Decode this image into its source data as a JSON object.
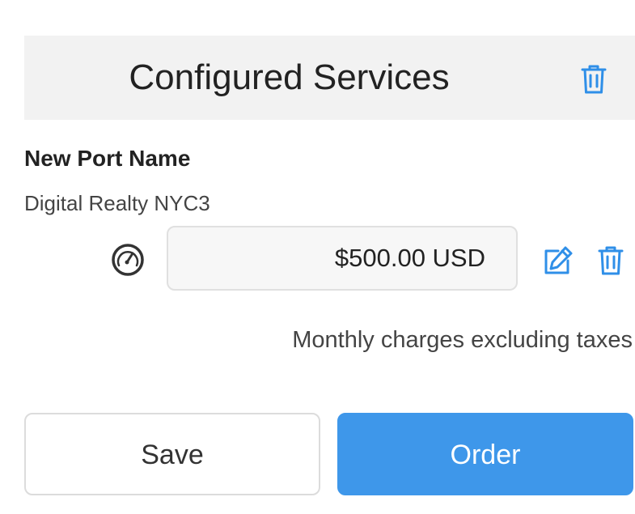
{
  "panel": {
    "title": "Configured Services",
    "title_icon": "trash-icon"
  },
  "service": {
    "name": "New Port Name",
    "location": "Digital Realty NYC3",
    "speed_icon": "speedometer-icon",
    "price": "$500.00 USD",
    "edit_icon": "edit-icon",
    "delete_icon": "trash-icon"
  },
  "note": "Monthly charges excluding taxes",
  "actions": {
    "save_label": "Save",
    "order_label": "Order"
  },
  "colors": {
    "accent": "#3e97ea",
    "header_bg": "#f2f2f2",
    "icon": "#2f8fe8"
  }
}
